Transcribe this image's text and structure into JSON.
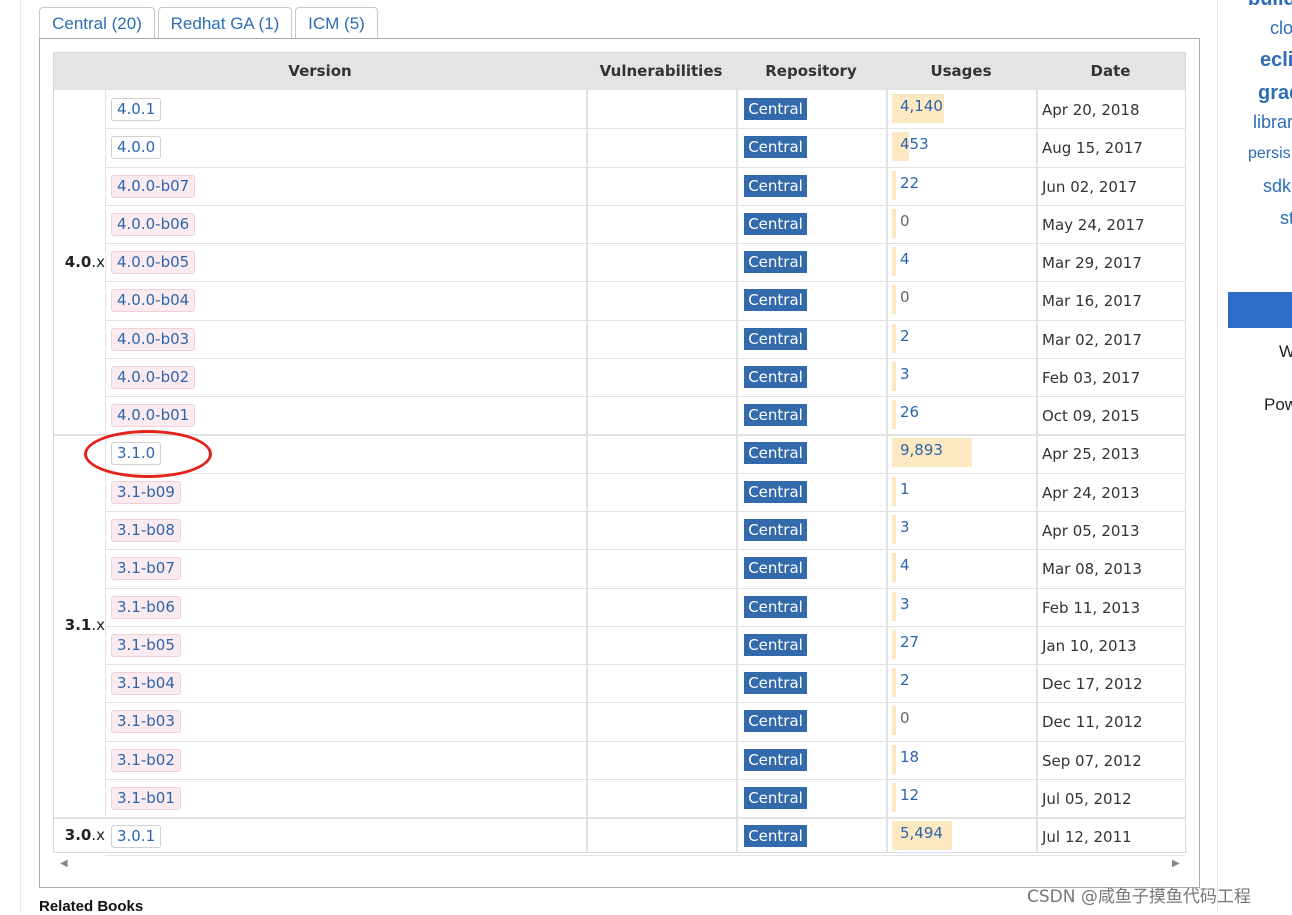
{
  "tabs": [
    {
      "label": "Central (20)",
      "active": true
    },
    {
      "label": "Redhat GA (1)",
      "active": false
    },
    {
      "label": "ICM (5)",
      "active": false
    }
  ],
  "table": {
    "headers": {
      "version": "Version",
      "vulnerabilities": "Vulnerabilities",
      "repository": "Repository",
      "usages": "Usages",
      "date": "Date"
    },
    "groups": [
      {
        "major": "4.0",
        "suffix": ".x"
      },
      {
        "major": "3.1",
        "suffix": ".x"
      },
      {
        "major": "3.0",
        "suffix": ".x"
      }
    ],
    "rows": [
      {
        "version": "4.0.1",
        "beta": false,
        "repository": "Central",
        "usages": "4,140",
        "usage_count": 4140,
        "date": "Apr 20, 2018"
      },
      {
        "version": "4.0.0",
        "beta": false,
        "repository": "Central",
        "usages": "453",
        "usage_count": 453,
        "date": "Aug 15, 2017"
      },
      {
        "version": "4.0.0-b07",
        "beta": true,
        "repository": "Central",
        "usages": "22",
        "usage_count": 22,
        "date": "Jun 02, 2017"
      },
      {
        "version": "4.0.0-b06",
        "beta": true,
        "repository": "Central",
        "usages": "0",
        "usage_count": 0,
        "date": "May 24, 2017"
      },
      {
        "version": "4.0.0-b05",
        "beta": true,
        "repository": "Central",
        "usages": "4",
        "usage_count": 4,
        "date": "Mar 29, 2017"
      },
      {
        "version": "4.0.0-b04",
        "beta": true,
        "repository": "Central",
        "usages": "0",
        "usage_count": 0,
        "date": "Mar 16, 2017"
      },
      {
        "version": "4.0.0-b03",
        "beta": true,
        "repository": "Central",
        "usages": "2",
        "usage_count": 2,
        "date": "Mar 02, 2017"
      },
      {
        "version": "4.0.0-b02",
        "beta": true,
        "repository": "Central",
        "usages": "3",
        "usage_count": 3,
        "date": "Feb 03, 2017"
      },
      {
        "version": "4.0.0-b01",
        "beta": true,
        "repository": "Central",
        "usages": "26",
        "usage_count": 26,
        "date": "Oct 09, 2015"
      },
      {
        "version": "3.1.0",
        "beta": false,
        "repository": "Central",
        "usages": "9,893",
        "usage_count": 9893,
        "date": "Apr 25, 2013"
      },
      {
        "version": "3.1-b09",
        "beta": true,
        "repository": "Central",
        "usages": "1",
        "usage_count": 1,
        "date": "Apr 24, 2013"
      },
      {
        "version": "3.1-b08",
        "beta": true,
        "repository": "Central",
        "usages": "3",
        "usage_count": 3,
        "date": "Apr 05, 2013"
      },
      {
        "version": "3.1-b07",
        "beta": true,
        "repository": "Central",
        "usages": "4",
        "usage_count": 4,
        "date": "Mar 08, 2013"
      },
      {
        "version": "3.1-b06",
        "beta": true,
        "repository": "Central",
        "usages": "3",
        "usage_count": 3,
        "date": "Feb 11, 2013"
      },
      {
        "version": "3.1-b05",
        "beta": true,
        "repository": "Central",
        "usages": "27",
        "usage_count": 27,
        "date": "Jan 10, 2013"
      },
      {
        "version": "3.1-b04",
        "beta": true,
        "repository": "Central",
        "usages": "2",
        "usage_count": 2,
        "date": "Dec 17, 2012"
      },
      {
        "version": "3.1-b03",
        "beta": true,
        "repository": "Central",
        "usages": "0",
        "usage_count": 0,
        "date": "Dec 11, 2012"
      },
      {
        "version": "3.1-b02",
        "beta": true,
        "repository": "Central",
        "usages": "18",
        "usage_count": 18,
        "date": "Sep 07, 2012"
      },
      {
        "version": "3.1-b01",
        "beta": true,
        "repository": "Central",
        "usages": "12",
        "usage_count": 12,
        "date": "Jul 05, 2012"
      },
      {
        "version": "3.0.1",
        "beta": false,
        "repository": "Central",
        "usages": "5,494",
        "usage_count": 5494,
        "date": "Jul 12, 2011"
      }
    ],
    "scroll_left": "◀",
    "scroll_right": "▶"
  },
  "related_books": "Related Books",
  "sidebar": {
    "items": [
      {
        "text": "build",
        "bold": true
      },
      {
        "text": "clo",
        "bold": false
      },
      {
        "text": "ecli",
        "bold": true
      },
      {
        "text": "grad",
        "bold": true
      },
      {
        "text": "librar",
        "bold": false
      },
      {
        "text": "persis",
        "bold": false
      },
      {
        "text": "sdk",
        "bold": false
      },
      {
        "text": "st",
        "bold": false
      }
    ],
    "text_w": "W",
    "text_pow": "Pow"
  },
  "watermark": "CSDN @咸鱼子摸鱼代码工程",
  "colors": {
    "link": "#2a66ad",
    "repo_badge": "#336aab",
    "usage_bar": "#fde8c2",
    "beta_bg": "#fbeaef",
    "highlight_circle": "#e3231b"
  }
}
